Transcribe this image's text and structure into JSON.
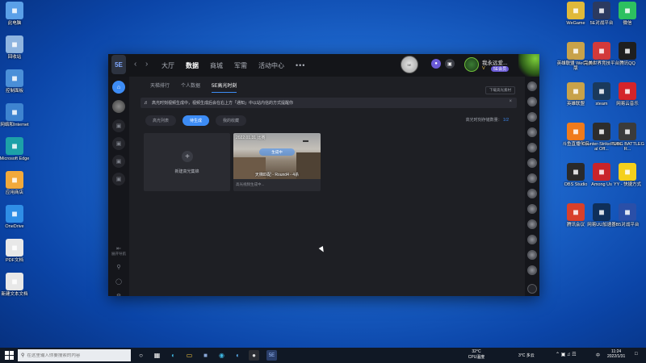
{
  "desktop_left": [
    {
      "label": "此电脑",
      "icon": "computer-icon",
      "color": "#5aa0e8"
    },
    {
      "label": "回收站",
      "icon": "recycle-bin-icon",
      "color": "#8fb5e0"
    },
    {
      "label": "控制面板",
      "icon": "control-panel-icon",
      "color": "#4a8fd8"
    },
    {
      "label": "网络和Internet",
      "icon": "network-icon",
      "color": "#3e84d0"
    },
    {
      "label": "Microsoft Edge",
      "icon": "edge-icon",
      "color": "#1da1a8"
    },
    {
      "label": "应用商店",
      "icon": "store-icon",
      "color": "#f2a93b"
    },
    {
      "label": "OneDrive",
      "icon": "onedrive-icon",
      "color": "#2f8ee6"
    },
    {
      "label": "PDF文档",
      "icon": "document-icon",
      "color": "#e8e8e8"
    },
    {
      "label": "新建文本文档",
      "icon": "text-file-icon",
      "color": "#e8e8e8"
    }
  ],
  "desktop_right": [
    {
      "label": "WeGame",
      "icon": "wegame-icon",
      "color": "#e0b93a"
    },
    {
      "label": "5E对战平台",
      "icon": "5e-platform-icon",
      "color": "#2b3a60"
    },
    {
      "label": "微信",
      "icon": "wechat-icon",
      "color": "#2dc160"
    },
    {
      "label": "英雄联盟 WeGame版",
      "icon": "lol-icon",
      "color": "#c8a24a"
    },
    {
      "label": "完美世界竞技平台",
      "icon": "perfect-world-icon",
      "color": "#d23a3a"
    },
    {
      "label": "腾讯QQ",
      "icon": "qq-icon",
      "color": "#1f1f1f"
    },
    {
      "label": "英雄联盟",
      "icon": "league-icon",
      "color": "#c8a24a"
    },
    {
      "label": "steam",
      "icon": "steam-icon",
      "color": "#1b3a5c"
    },
    {
      "label": "网易云音乐",
      "icon": "netease-music-icon",
      "color": "#d4242a"
    },
    {
      "label": "斗鱼直播伴侣",
      "icon": "douyu-icon",
      "color": "#f07b1c"
    },
    {
      "label": "Counter-Strike Global Off...",
      "icon": "csgo-icon",
      "color": "#2d2d2d"
    },
    {
      "label": "PUBG BATTLEGR...",
      "icon": "pubg-icon",
      "color": "#3b3b3b"
    },
    {
      "label": "OBS Studio",
      "icon": "obs-icon",
      "color": "#2a2a2a"
    },
    {
      "label": "Among Us",
      "icon": "among-us-icon",
      "color": "#c9242a"
    },
    {
      "label": "YY - 快捷方式",
      "icon": "yy-icon",
      "color": "#f4d01c"
    },
    {
      "label": "腾讯会议",
      "icon": "tencent-meeting-icon",
      "color": "#d8402a"
    },
    {
      "label": "网易UU加速器",
      "icon": "uu-icon",
      "color": "#0f2f5a"
    },
    {
      "label": "B5对战平台",
      "icon": "b5-icon",
      "color": "#2a4fa8"
    }
  ],
  "app": {
    "logo": "5E",
    "nav": [
      "大厅",
      "数据",
      "商城",
      "军需",
      "活动中心"
    ],
    "nav_more": "•••",
    "top_badge": "5E",
    "user": {
      "name": "我永远爱...",
      "level": "V",
      "badge": "5E会员"
    },
    "subtabs": [
      "天梯排行",
      "个人数据",
      "5E高光时刻"
    ],
    "right_action": "下载高光素材",
    "notice": "高光时刻视频生成中，视频生成后会在右上方「通知」中以站内信的方式提醒你",
    "filters": [
      "高光列表",
      "待生成",
      "我的收藏"
    ],
    "storage_label": "高光时刻存储数量：",
    "storage_value": "1/2",
    "new_card_label": "新建高光集锦",
    "video": {
      "date": "2022.01.31 比赛",
      "status": "生成中",
      "title": "天梯匹配 - Round4 - 4杀",
      "sub": "高光视频生成中..."
    },
    "left_rail_label": "展开导航"
  },
  "taskbar": {
    "search_placeholder": "在这里输入你要搜索的内容",
    "weather": "32°C",
    "cpu": "CPU温度",
    "temp": "3°C 多云",
    "lang": "中",
    "time": "11:24",
    "date": "2022/1/31"
  },
  "colors": {
    "accent": "#3d8cf5",
    "panel": "#1e1f24",
    "taskbar": "#101825"
  }
}
